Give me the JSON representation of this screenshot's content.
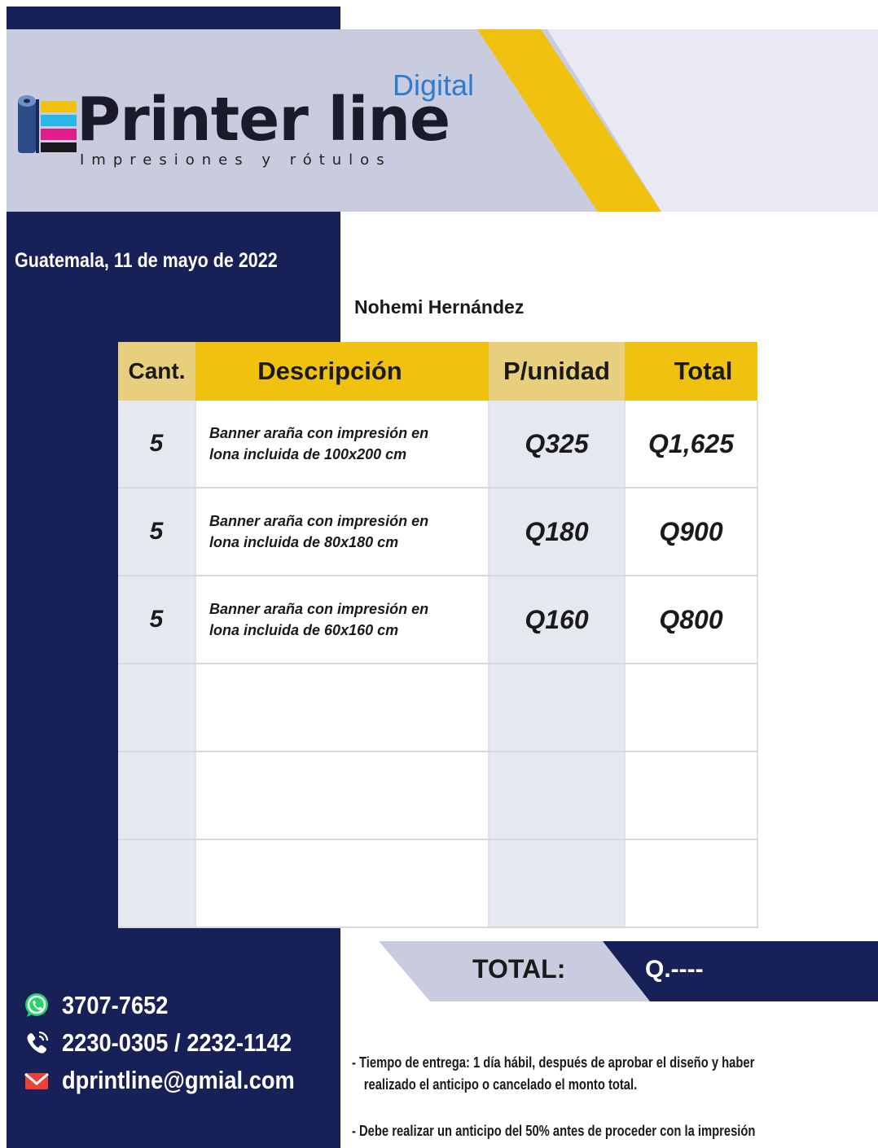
{
  "brand": {
    "name": "Printer line",
    "subbrand": "Digital",
    "tagline": "Impresiones y rótulos",
    "colors": {
      "navy": "#172057",
      "yellow": "#f1c10f",
      "light": "#c9ccdf"
    }
  },
  "date": "Guatemala, 11 de mayo de 2022",
  "client": "Nohemi Hernández",
  "table": {
    "headers": {
      "qty": "Cant.",
      "description": "Descripción",
      "unit_price": "P/unidad",
      "total": "Total"
    },
    "rows": [
      {
        "qty": "5",
        "description_line1": "Banner araña con impresión en",
        "description_line2": "lona incluida de 100x200 cm",
        "unit_price": "Q325",
        "total": "Q1,625"
      },
      {
        "qty": "5",
        "description_line1": "Banner araña con impresión en",
        "description_line2": "lona incluida de 80x180 cm",
        "unit_price": "Q180",
        "total": "Q900"
      },
      {
        "qty": "5",
        "description_line1": "Banner araña con impresión en",
        "description_line2": "lona incluida de 60x160 cm",
        "unit_price": "Q160",
        "total": "Q800"
      },
      {
        "qty": "",
        "description_line1": "",
        "description_line2": "",
        "unit_price": "",
        "total": ""
      },
      {
        "qty": "",
        "description_line1": "",
        "description_line2": "",
        "unit_price": "",
        "total": ""
      },
      {
        "qty": "",
        "description_line1": "",
        "description_line2": "",
        "unit_price": "",
        "total": ""
      }
    ]
  },
  "summary": {
    "total_label": "TOTAL:",
    "total_value": "Q.----"
  },
  "contact": {
    "whatsapp": "3707-7652",
    "phones": "2230-0305 / 2232-1142",
    "email": "dprintline@gmial.com",
    "icons": [
      "whatsapp-icon",
      "phone-icon",
      "mail-icon"
    ]
  },
  "notes": {
    "note1_line1": "- Tiempo de entrega: 1 día hábil, después de aprobar el diseño y haber",
    "note1_line2": "realizado el anticipo o cancelado el monto total.",
    "note2": "- Debe realizar un anticipo del 50% antes de proceder con la impresión"
  }
}
